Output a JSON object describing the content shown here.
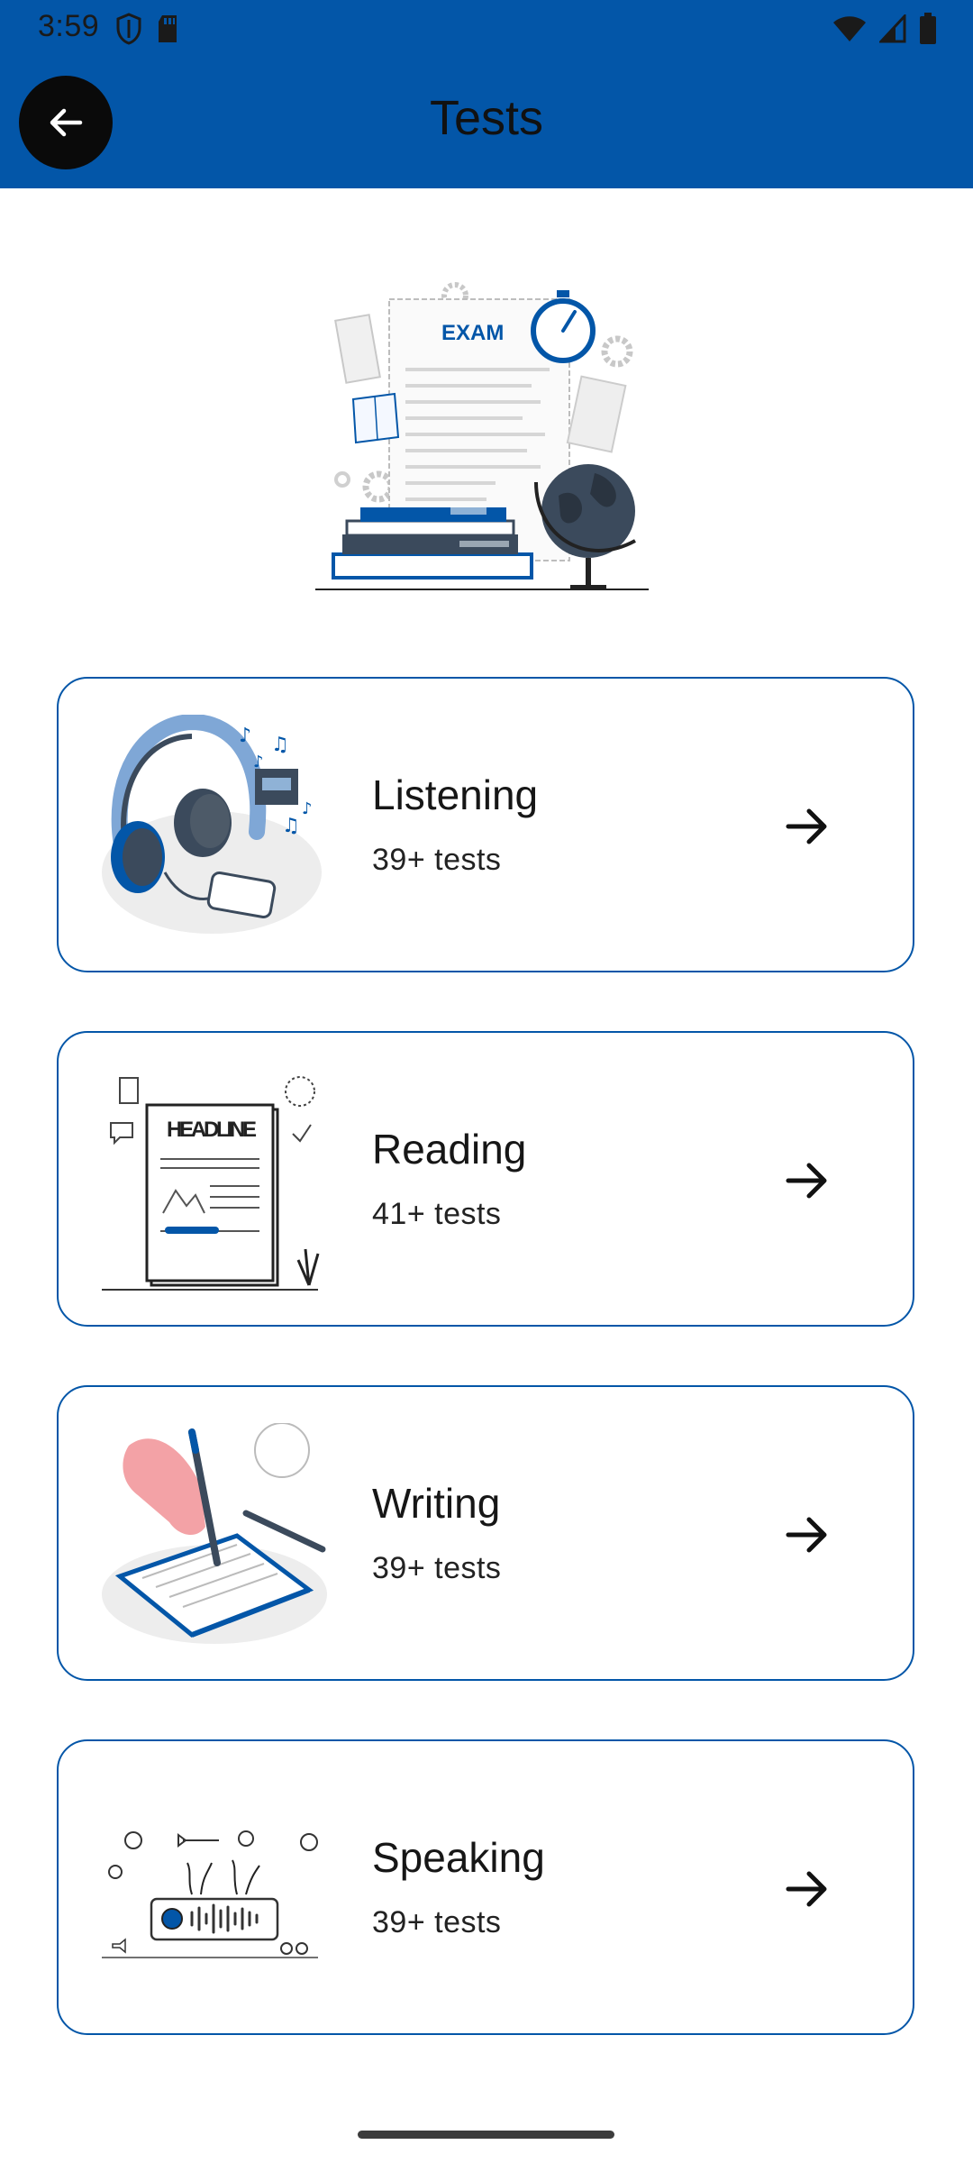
{
  "status_bar": {
    "time": "3:59"
  },
  "header": {
    "title": "Tests",
    "back_icon": "arrow-back-icon"
  },
  "hero": {
    "exam_label": "EXAM"
  },
  "cards": [
    {
      "title": "Listening",
      "subtitle": "39+ tests",
      "icon": "headphones-illustration"
    },
    {
      "title": "Reading",
      "subtitle": "41+ tests",
      "icon": "newspaper-illustration",
      "illustration_text": "HEADLINE"
    },
    {
      "title": "Writing",
      "subtitle": "39+ tests",
      "icon": "hand-writing-illustration"
    },
    {
      "title": "Speaking",
      "subtitle": "39+ tests",
      "icon": "voice-wave-illustration"
    }
  ],
  "colors": {
    "primary": "#0356a8",
    "card_border": "#0356a8",
    "text": "#161616"
  }
}
